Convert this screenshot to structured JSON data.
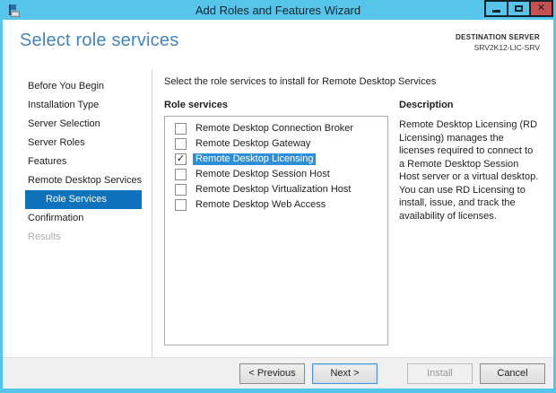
{
  "window": {
    "title": "Add Roles and Features Wizard"
  },
  "icons": {
    "minimize": "minimize-bar",
    "maximize": "maximize-box",
    "close": "✕",
    "check": "✓",
    "app": "server-manager-wizard"
  },
  "header": {
    "title": "Select role services",
    "destination_label": "DESTINATION SERVER",
    "destination_server": "SRV2K12-LIC-SRV"
  },
  "sidebar": {
    "items": [
      {
        "label": "Before You Begin",
        "state": "normal"
      },
      {
        "label": "Installation Type",
        "state": "normal"
      },
      {
        "label": "Server Selection",
        "state": "normal"
      },
      {
        "label": "Server Roles",
        "state": "normal"
      },
      {
        "label": "Features",
        "state": "normal"
      },
      {
        "label": "Remote Desktop Services",
        "state": "normal"
      },
      {
        "label": "Role Services",
        "state": "selected"
      },
      {
        "label": "Confirmation",
        "state": "normal"
      },
      {
        "label": "Results",
        "state": "disabled"
      }
    ]
  },
  "main": {
    "instruction": "Select the role services to install for Remote Desktop Services",
    "list_label": "Role services",
    "role_services": [
      {
        "label": "Remote Desktop Connection Broker",
        "checked": false,
        "selected": false
      },
      {
        "label": "Remote Desktop Gateway",
        "checked": false,
        "selected": false
      },
      {
        "label": "Remote Desktop Licensing",
        "checked": true,
        "selected": true
      },
      {
        "label": "Remote Desktop Session Host",
        "checked": false,
        "selected": false
      },
      {
        "label": "Remote Desktop Virtualization Host",
        "checked": false,
        "selected": false
      },
      {
        "label": "Remote Desktop Web Access",
        "checked": false,
        "selected": false
      }
    ]
  },
  "description": {
    "title": "Description",
    "text": "Remote Desktop Licensing (RD Licensing) manages the licenses required to connect to a Remote Desktop Session Host server or a virtual desktop. You can use RD Licensing to install, issue, and track the availability of licenses."
  },
  "footer": {
    "buttons": [
      {
        "label": "< Previous",
        "state": "normal"
      },
      {
        "label": "Next >",
        "state": "default"
      },
      {
        "label": "Install",
        "state": "disabled"
      },
      {
        "label": "Cancel",
        "state": "normal"
      }
    ]
  },
  "colors": {
    "titlebar": "#57C5E9",
    "close_button": "#C75050",
    "heading": "#4384BC",
    "sidebar_selected_bg": "#0E72BC",
    "list_selected_bg": "#2E8FD9",
    "footer_bg": "#F0F0F0"
  }
}
